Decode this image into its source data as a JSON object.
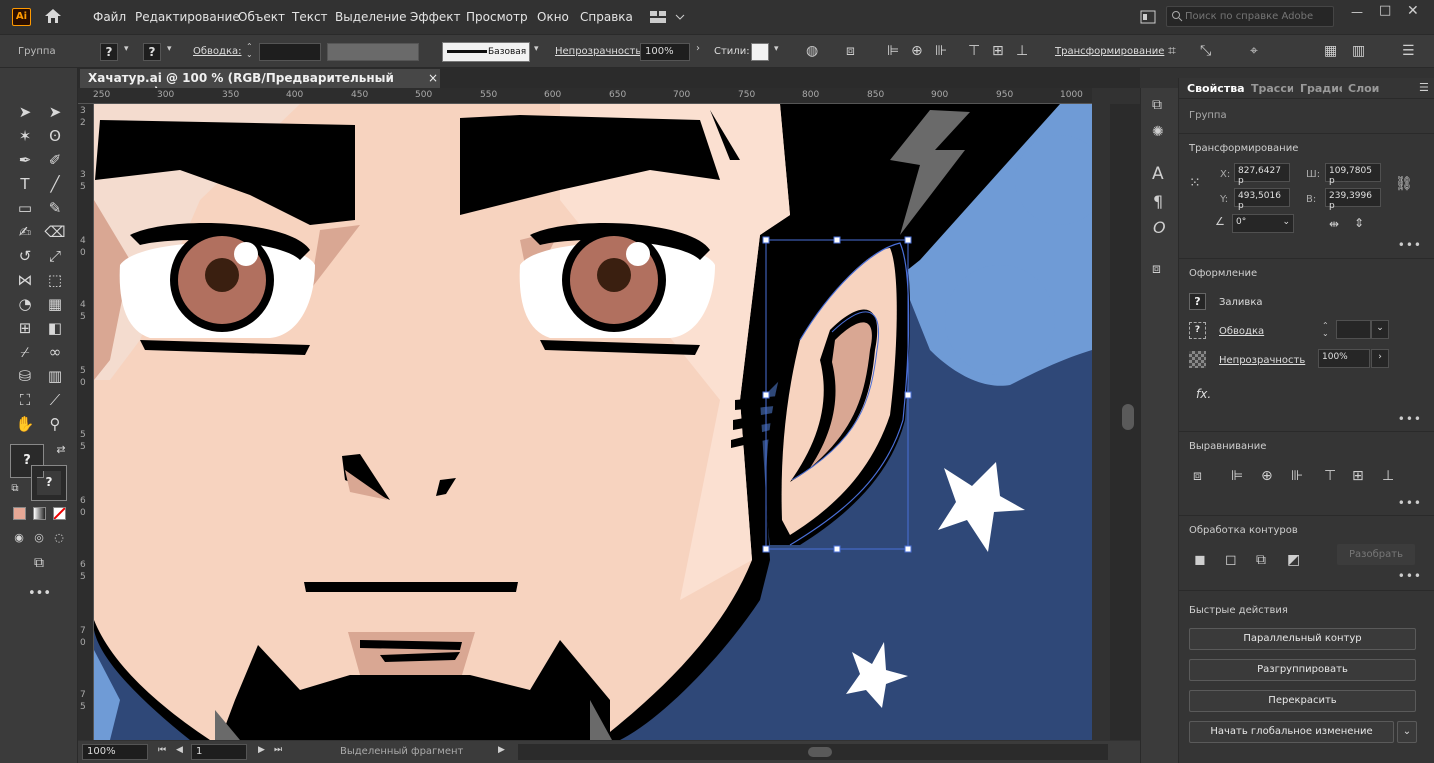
{
  "app": {
    "logo": "Ai",
    "home_icon": "home-icon"
  },
  "menu": [
    "Файл",
    "Редактирование",
    "Объект",
    "Текст",
    "Выделение",
    "Эффект",
    "Просмотр",
    "Окно",
    "Справка"
  ],
  "search": {
    "placeholder": "Поиск по справке Adobe"
  },
  "control": {
    "selection_type": "Группа",
    "stroke_label": "Обводка:",
    "stroke_style": "Базовая",
    "opacity_label": "Непрозрачность:",
    "opacity_value": "100%",
    "styles_label": "Стили:",
    "transform_label": "Трансформирование"
  },
  "document": {
    "tab_title": "Хачатур.ai @ 100 % (RGB/Предварительный просмотр)",
    "close": "×"
  },
  "ruler": {
    "h": [
      "250",
      "300",
      "350",
      "400",
      "450",
      "500",
      "550",
      "600",
      "650",
      "700",
      "750",
      "800",
      "850",
      "900",
      "950",
      "1000"
    ],
    "v": [
      "3",
      "2",
      "3",
      "5",
      "4",
      "0",
      "4",
      "5",
      "5",
      "0",
      "5",
      "5",
      "6",
      "0",
      "6",
      "5",
      "7",
      "0",
      "7",
      "5"
    ]
  },
  "status": {
    "zoom": "100%",
    "artboard": "1",
    "mode": "Выделенный фрагмент"
  },
  "panel": {
    "tabs": [
      "Свойства",
      "Трассиј",
      "Градиен",
      "Слои"
    ],
    "selection": "Группа",
    "transform": {
      "title": "Трансформирование",
      "x_label": "X:",
      "x": "827,6427 р",
      "y_label": "Y:",
      "y": "493,5016 р",
      "w_label": "Ш:",
      "w": "109,7805 р",
      "h_label": "В:",
      "h": "239,3996 р",
      "angle": "0°"
    },
    "appearance": {
      "title": "Оформление",
      "fill": "Заливка",
      "stroke": "Обводка",
      "opacity": "Непрозрачность",
      "opacity_value": "100%",
      "fx": "fx."
    },
    "align": {
      "title": "Выравнивание"
    },
    "pathfinder": {
      "title": "Обработка контуров",
      "expand": "Разобрать"
    },
    "quick": {
      "title": "Быстрые действия",
      "buttons": [
        "Параллельный контур",
        "Разгруппировать",
        "Перекрасить",
        "Начать глобальное изменение"
      ]
    }
  },
  "colors": {
    "accent": "#4a6fd8",
    "bg": "#323232",
    "sky": "#2f4878",
    "skin": "#f7d3bf"
  }
}
